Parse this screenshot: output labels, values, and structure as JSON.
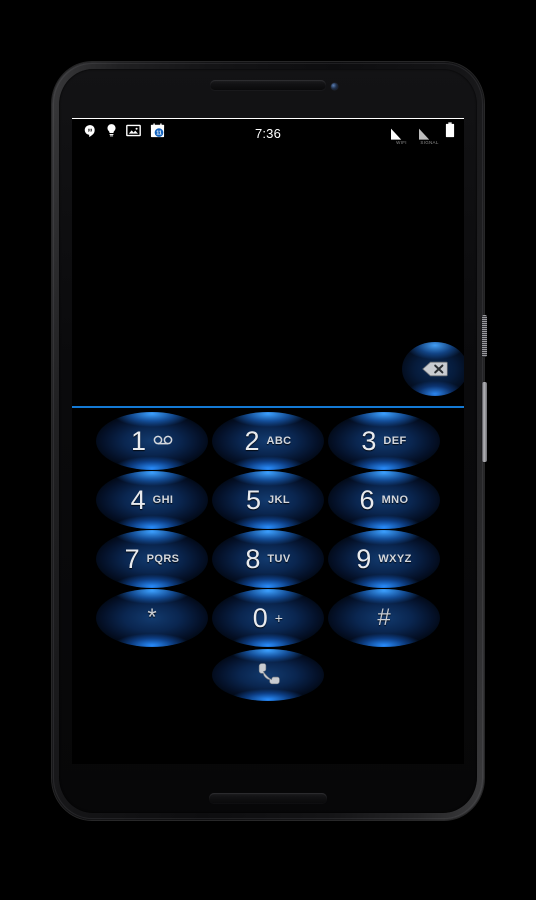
{
  "device": {
    "name": "android-phone",
    "earpiece": "earpiece-speaker",
    "front_camera": "front-camera",
    "bottom_speaker": "bottom-speaker",
    "power_button": "power-button",
    "volume_button": "volume-rocker"
  },
  "status_bar": {
    "clock": "7:36",
    "left_icons": [
      {
        "name": "hangouts-icon",
        "label": "Hangouts"
      },
      {
        "name": "lightbulb-icon",
        "label": "Tip"
      },
      {
        "name": "screenshot-image-icon",
        "label": "Screenshot"
      },
      {
        "name": "calendar-icon",
        "label": "Calendar",
        "day": "11"
      }
    ],
    "right_icons": [
      {
        "name": "wifi-signal-icon",
        "label": "WIFI"
      },
      {
        "name": "cellular-signal-icon",
        "label": "SIGNAL"
      },
      {
        "name": "battery-icon",
        "label": "Battery"
      }
    ]
  },
  "dialer": {
    "input": {
      "name": "phone-number-input",
      "value": "",
      "placeholder": ""
    },
    "backspace": {
      "name": "backspace-button",
      "label": "Delete"
    },
    "divider_color": "#1479d4",
    "accent_color": "#1479d4",
    "key_glow_color": "#2d8cfc",
    "keys": [
      [
        {
          "digit": "1",
          "sub": "",
          "icon": "voicemail-icon",
          "name": "dial-key-1"
        },
        {
          "digit": "2",
          "sub": "ABC",
          "icon": "",
          "name": "dial-key-2"
        },
        {
          "digit": "3",
          "sub": "DEF",
          "icon": "",
          "name": "dial-key-3"
        }
      ],
      [
        {
          "digit": "4",
          "sub": "GHI",
          "icon": "",
          "name": "dial-key-4"
        },
        {
          "digit": "5",
          "sub": "JKL",
          "icon": "",
          "name": "dial-key-5"
        },
        {
          "digit": "6",
          "sub": "MNO",
          "icon": "",
          "name": "dial-key-6"
        }
      ],
      [
        {
          "digit": "7",
          "sub": "PQRS",
          "icon": "",
          "name": "dial-key-7"
        },
        {
          "digit": "8",
          "sub": "TUV",
          "icon": "",
          "name": "dial-key-8"
        },
        {
          "digit": "9",
          "sub": "WXYZ",
          "icon": "",
          "name": "dial-key-9"
        }
      ],
      [
        {
          "digit": "*",
          "sub": "",
          "icon": "",
          "name": "dial-key-star"
        },
        {
          "digit": "0",
          "sub": "+",
          "icon": "",
          "name": "dial-key-0"
        },
        {
          "digit": "#",
          "sub": "",
          "icon": "",
          "name": "dial-key-hash"
        }
      ]
    ],
    "call_button": {
      "name": "call-button",
      "icon": "phone-handset-icon",
      "label": "Call"
    }
  }
}
